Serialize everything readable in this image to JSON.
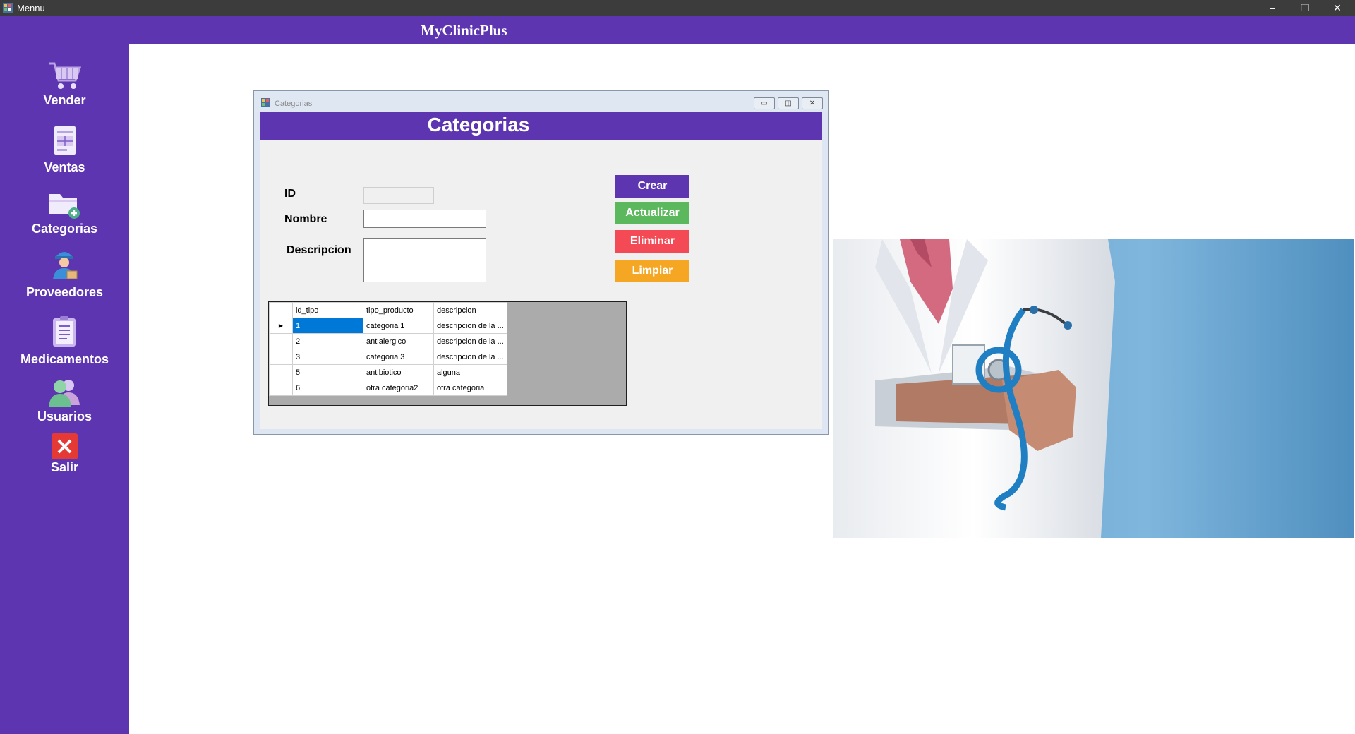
{
  "window": {
    "title": "Mennu",
    "controls": {
      "minimize": "–",
      "restore": "❐",
      "close": "✕"
    }
  },
  "header": {
    "brand": "MyClinicPlus"
  },
  "sidebar": {
    "items": [
      {
        "label": "Vender",
        "icon": "cart-icon"
      },
      {
        "label": "Ventas",
        "icon": "invoice-icon"
      },
      {
        "label": "Categorias",
        "icon": "folder-add-icon"
      },
      {
        "label": "Proveedores",
        "icon": "supplier-icon"
      },
      {
        "label": "Medicamentos",
        "icon": "clipboard-icon"
      },
      {
        "label": "Usuarios",
        "icon": "users-icon"
      },
      {
        "label": "Salir",
        "icon": "exit-icon"
      }
    ]
  },
  "child_window": {
    "title": "Categorias",
    "banner": "Categorias",
    "fields": {
      "id": {
        "label": "ID",
        "value": ""
      },
      "nombre": {
        "label": "Nombre",
        "value": ""
      },
      "descripcion": {
        "label": "Descripcion",
        "value": ""
      }
    },
    "buttons": {
      "crear": "Crear",
      "actualizar": "Actualizar",
      "eliminar": "Eliminar",
      "limpiar": "Limpiar"
    },
    "grid": {
      "columns": [
        "id_tipo",
        "tipo_producto",
        "descripcion"
      ],
      "rows": [
        [
          "1",
          "categoria 1",
          "descripcion de la ..."
        ],
        [
          "2",
          "antialergico",
          "descripcion de la ..."
        ],
        [
          "3",
          "categoria 3",
          "descripcion de la ..."
        ],
        [
          "5",
          "antibiotico",
          "alguna"
        ],
        [
          "6",
          "otra categoria2",
          "otra categoria"
        ]
      ],
      "current_row_marker": "▶"
    }
  },
  "colors": {
    "brand_purple": "#5e35b1",
    "crear": "#5e35b1",
    "actualizar": "#5cb85c",
    "eliminar": "#f44a55",
    "limpiar": "#f5a623",
    "selection": "#0078d7"
  }
}
